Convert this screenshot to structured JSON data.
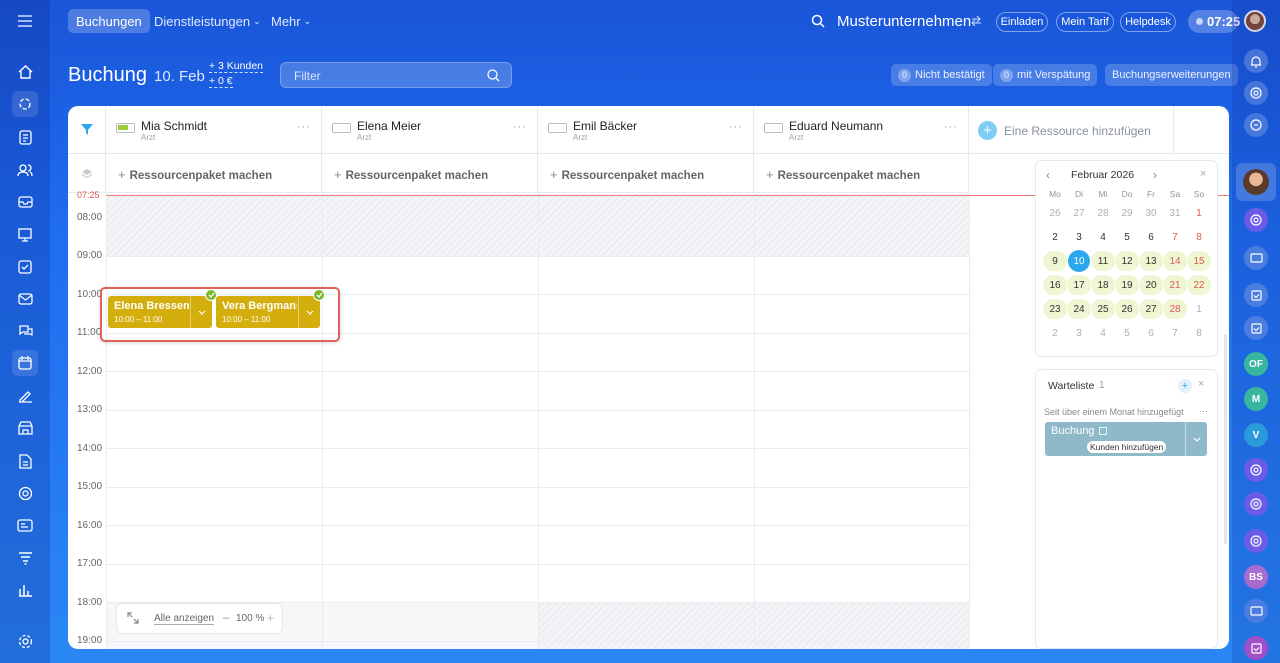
{
  "topnav": {
    "tabs": [
      "Buchungen",
      "Dienstleistungen",
      "Mehr"
    ],
    "company": "Musterunternehmen",
    "invite": "Einladen",
    "tariff": "Mein Tarif",
    "helpdesk": "Helpdesk",
    "time": "07:25"
  },
  "header": {
    "title": "Buchung",
    "date": "10. Feb",
    "clients": "+ 3 Kunden",
    "amount": "+ 0 €",
    "filter_placeholder": "Filter",
    "unconfirmed_count": "0",
    "unconfirmed_label": "Nicht bestätigt",
    "late_count": "0",
    "late_label": "mit Verspätung",
    "extensions": "Buchungserweiterungen"
  },
  "resources": [
    {
      "name": "Mia Schmidt",
      "role": "Arzt"
    },
    {
      "name": "Elena Meier",
      "role": "Arzt"
    },
    {
      "name": "Emil Bäcker",
      "role": "Arzt"
    },
    {
      "name": "Eduard Neumann",
      "role": "Arzt"
    }
  ],
  "add_resource": "Eine Ressource hinzufügen",
  "package_label": "Ressourcenpaket machen",
  "hours": [
    "07:25",
    "08:00",
    "09:00",
    "10:00",
    "11:00",
    "12:00",
    "13:00",
    "14:00",
    "15:00",
    "16:00",
    "17:00",
    "18:00",
    "19:00"
  ],
  "events": [
    {
      "name": "Elena Bressem",
      "time": "10:00 – 11:00"
    },
    {
      "name": "Vera Bergmann",
      "time": "10:00 – 11:00"
    }
  ],
  "bottom": {
    "show_all": "Alle anzeigen",
    "zoom": "100 %",
    "minus": "–",
    "plus": "+"
  },
  "calendar": {
    "month": "Februar 2026",
    "weekdays": [
      "Mo",
      "Di",
      "Mi",
      "Do",
      "Fr",
      "Sa",
      "So"
    ],
    "weeks": [
      [
        "26",
        "27",
        "28",
        "29",
        "30",
        "31",
        "1"
      ],
      [
        "2",
        "3",
        "4",
        "5",
        "6",
        "7",
        "8"
      ],
      [
        "9",
        "10",
        "11",
        "12",
        "13",
        "14",
        "15"
      ],
      [
        "16",
        "17",
        "18",
        "19",
        "20",
        "21",
        "22"
      ],
      [
        "23",
        "24",
        "25",
        "26",
        "27",
        "28",
        "1"
      ],
      [
        "2",
        "3",
        "4",
        "5",
        "6",
        "7",
        "8"
      ]
    ]
  },
  "waitlist": {
    "title": "Warteliste",
    "count": "1",
    "added": "Seit über einem Monat hinzugefügt",
    "booking": "Buchung",
    "add_clients": "Kunden hinzufügen"
  },
  "right_rail": {
    "initials": [
      "OF",
      "M",
      "V",
      "BS"
    ]
  },
  "colors": {
    "accent": "#2aa7ee",
    "event": "#d4ae0d",
    "now_line": "#f07d7d"
  }
}
